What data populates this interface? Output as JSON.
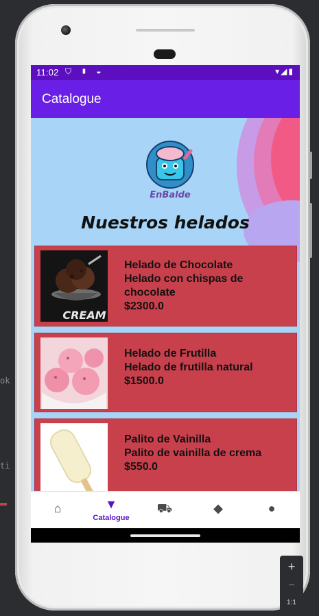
{
  "ide": {
    "left_fragment_1": "ok",
    "left_fragment_2": "ti"
  },
  "status_bar": {
    "time": "11:02",
    "left_icons": "⛉ ▮ ◒",
    "right_icons": "▾◢▮"
  },
  "app_bar": {
    "title": "Catalogue"
  },
  "banner": {
    "logo_text": "EnBalde",
    "heading": "Nuestros helados"
  },
  "products": [
    {
      "name": "Helado de Chocolate",
      "description": "Helado con chispas de chocolate",
      "price": "$2300.0",
      "thumb_label": "CREAM"
    },
    {
      "name": "Helado de Frutilla",
      "description": "Helado de frutilla natural",
      "price": "$1500.0"
    },
    {
      "name": "Palito de Vainilla",
      "description": "Palito de vainilla de crema",
      "price": "$550.0"
    }
  ],
  "bottom_nav": {
    "items": [
      {
        "key": "home",
        "label": "",
        "icon": "home-icon",
        "glyph": "⌂"
      },
      {
        "key": "catalogue",
        "label": "Catalogue",
        "icon": "ice-cream-icon",
        "glyph": "▼",
        "active": true
      },
      {
        "key": "cart",
        "label": "",
        "icon": "cart-icon",
        "glyph": "⛟"
      },
      {
        "key": "favorites",
        "label": "",
        "icon": "cone-icon",
        "glyph": "◆"
      },
      {
        "key": "profile",
        "label": "",
        "icon": "person-icon",
        "glyph": "●"
      }
    ]
  },
  "zoom": {
    "plus": "+",
    "minus": "−",
    "ratio": "1:1"
  },
  "colors": {
    "status_bar": "#5b0fbf",
    "app_bar": "#6a1fe6",
    "banner_bg": "#a8d5f7",
    "card_bg": "#c8404c",
    "accent": "#5b12c9"
  }
}
